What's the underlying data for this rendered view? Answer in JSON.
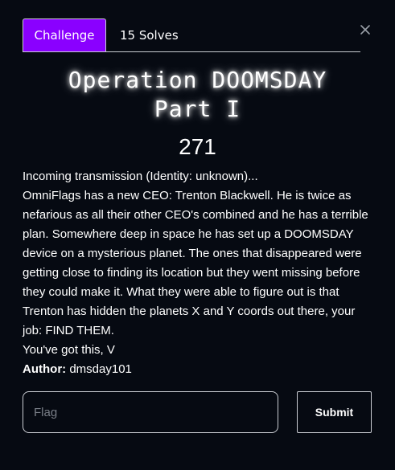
{
  "tabs": {
    "challenge_label": "Challenge",
    "solves_label": "15 Solves"
  },
  "challenge": {
    "title_line1": "Operation DOOMSDAY",
    "title_line2": "Part I",
    "points": "271",
    "description": [
      "Incoming transmission (Identity: unknown)...",
      "OmniFlags has a new CEO: Trenton Blackwell. He is twice as nefarious as all their other CEO's combined and he has a terrible plan. Somewhere deep in space he has set up a DOOMSDAY device on a mysterious planet. The ones that disappeared were getting close to finding its location but they went missing before they could make it. What they were able to figure out is that Trenton has hidden the planets X and Y coords out there, your job: FIND THEM.",
      "You've got this, V"
    ],
    "author_label": "Author:",
    "author_name": "dmsday101"
  },
  "form": {
    "flag_placeholder": "Flag",
    "flag_value": "",
    "submit_label": "Submit"
  },
  "icons": {
    "close": "close-icon"
  },
  "colors": {
    "background": "#060a12",
    "accent": "#8a00ff",
    "border": "#c9ccd2",
    "text": "#ffffff",
    "placeholder": "#7a7f88"
  }
}
